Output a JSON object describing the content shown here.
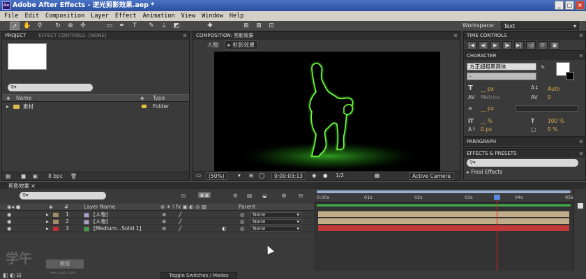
{
  "title": "Adobe After Effects - 逆光剪影效果.aep *",
  "app_icon_label": "Ae",
  "window_buttons": [
    "_",
    "□",
    "×"
  ],
  "menu": [
    "File",
    "Edit",
    "Composition",
    "Layer",
    "Effect",
    "Animation",
    "View",
    "Window",
    "Help"
  ],
  "toolbar": {
    "tools": [
      "selection-tool",
      "hand-tool",
      "zoom-tool",
      "rotation-tool",
      "orbit-camera-tool",
      "track-xy-tool",
      "rectangle-tool",
      "pen-tool",
      "type-tool",
      "brush-tool",
      "clone-stamp-tool",
      "eraser-tool",
      "puppet-pin-tool"
    ],
    "workspace_label": "Workspace:",
    "workspace_value": "Text"
  },
  "project": {
    "tabs": [
      "PROJECT",
      "EFFECT CONTROLS: (none)"
    ],
    "search_placeholder": "",
    "columns": [
      "Name",
      "Type"
    ],
    "items": [
      {
        "name": "素材",
        "type": "Folder"
      }
    ],
    "bpc": "8 bpc"
  },
  "composition": {
    "tab": "COMPOSITION: 剪影效果",
    "path": [
      "人物",
      "剪影效果"
    ],
    "zoom": "(50%)",
    "timecode": "0:00:03:13",
    "resolution": "1/2",
    "camera": "Active Camera"
  },
  "time_controls": {
    "tab": "TIME CONTROLS",
    "buttons": [
      "|◀",
      "◀|",
      "▶",
      "|▶",
      "▶|",
      "◁)",
      "⟳",
      "▣"
    ]
  },
  "character": {
    "tab": "CHARACTER",
    "font": "方正超粗黑简体",
    "style": "-",
    "font_size": "__ px",
    "leading": "Auto",
    "kerning": "Metrics",
    "tracking": "0",
    "stroke_width": "__ px",
    "vert_scale": "__ %",
    "horiz_scale": "100 %",
    "baseline": "0 px",
    "tsume": "0 %"
  },
  "paragraph": {
    "tab": "PARAGRAPH"
  },
  "effects": {
    "tab": "EFFECTS & PRESETS",
    "items": [
      "Final Effects"
    ]
  },
  "timeline": {
    "tab": "剪影效果",
    "columns": {
      "layer_name": "Layer Name",
      "parent": "Parent",
      "num": "#"
    },
    "ruler": [
      "0:00s",
      "01s",
      "02s",
      "03s",
      "04s",
      "05s"
    ],
    "playhead": 3.55,
    "duration": 5,
    "layers": [
      {
        "num": "1",
        "name": "[人物]",
        "color": "#a48a66",
        "parent": "None",
        "bar_color": "#c0ad8a"
      },
      {
        "num": "2",
        "name": "[人物]",
        "color": "#a48a66",
        "parent": "None",
        "bar_color": "#c0ad8a"
      },
      {
        "num": "3",
        "name": "[Medium...Solid 1]",
        "color": "#c03030",
        "parent": "None",
        "bar_color": "#c03a3a"
      }
    ],
    "toggle_label": "Toggle Switches / Modes"
  },
  "watermark": {
    "logo": "学午",
    "chip": "教程",
    "url": "ww.xue.com"
  }
}
